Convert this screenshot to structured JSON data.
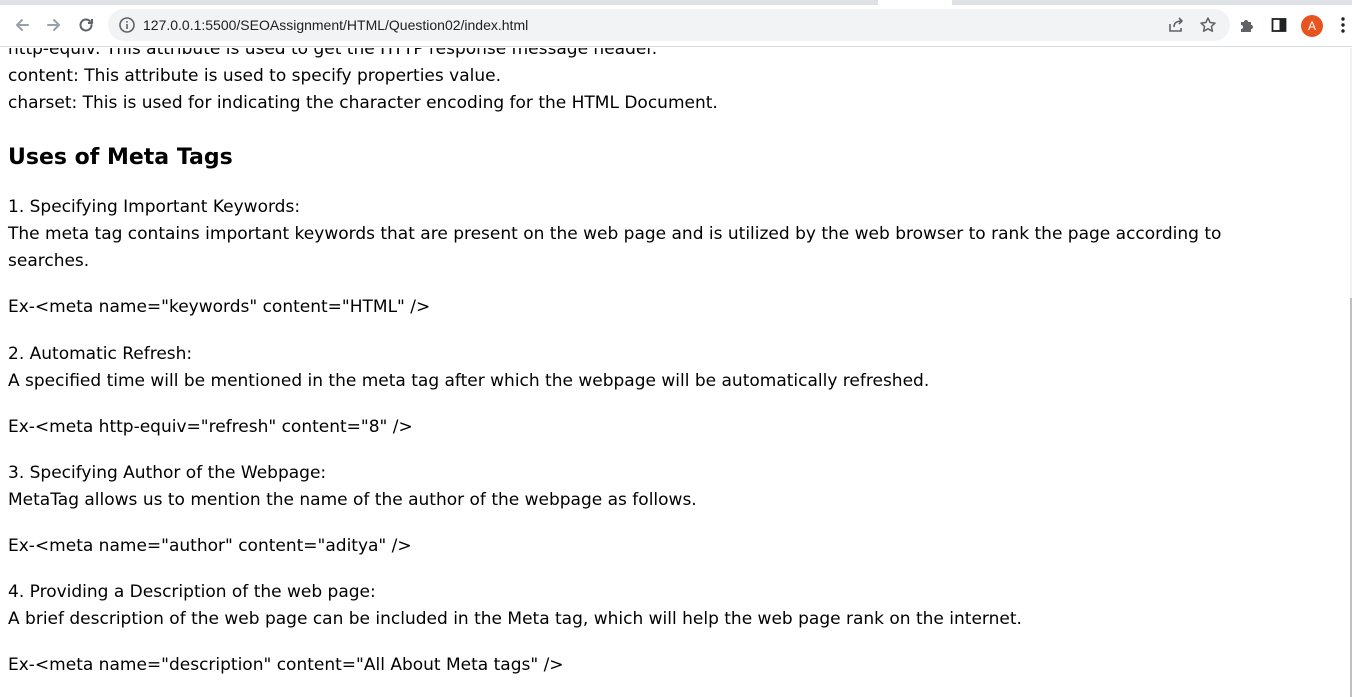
{
  "browser": {
    "url": "127.0.0.1:5500/SEOAssignment/HTML/Question02/index.html",
    "avatar_letter": "A",
    "icons": [
      "back-arrow-icon",
      "forward-arrow-icon",
      "reload-icon",
      "info-icon",
      "share-icon",
      "star-icon",
      "extensions-icon",
      "side-panel-icon",
      "more-menu-icon"
    ]
  },
  "page": {
    "attr_lines": [
      "http-equiv: This attribute is used to get the HTTP response message header.",
      "content: This attribute is used to specify properties value.",
      "charset: This is used for indicating the character encoding for the HTML Document."
    ],
    "heading": "Uses of Meta Tags",
    "sections": [
      {
        "title": "1. Specifying Important Keywords:",
        "desc": "The meta tag contains important keywords that are present on the web page and is utilized by the web browser to rank the page according to",
        "desc2": "searches.",
        "example": "Ex-<meta name=\"keywords\" content=\"HTML\" />"
      },
      {
        "title": "2. Automatic Refresh:",
        "desc": "A specified time will be mentioned in the meta tag after which the webpage will be automatically refreshed.",
        "example": "Ex-<meta http-equiv=\"refresh\" content=\"8\" />"
      },
      {
        "title": "3. Specifying Author of the Webpage:",
        "desc": "MetaTag allows us to mention the name of the author of the webpage as follows.",
        "example": "Ex-<meta name=\"author\" content=\"aditya\" />"
      },
      {
        "title": "4. Providing a Description of the web page:",
        "desc": "A brief description of the web page can be included in the Meta tag, which will help the web page rank on the internet.",
        "example": "Ex-<meta name=\"description\" content=\"All About Meta tags\" />"
      }
    ]
  }
}
